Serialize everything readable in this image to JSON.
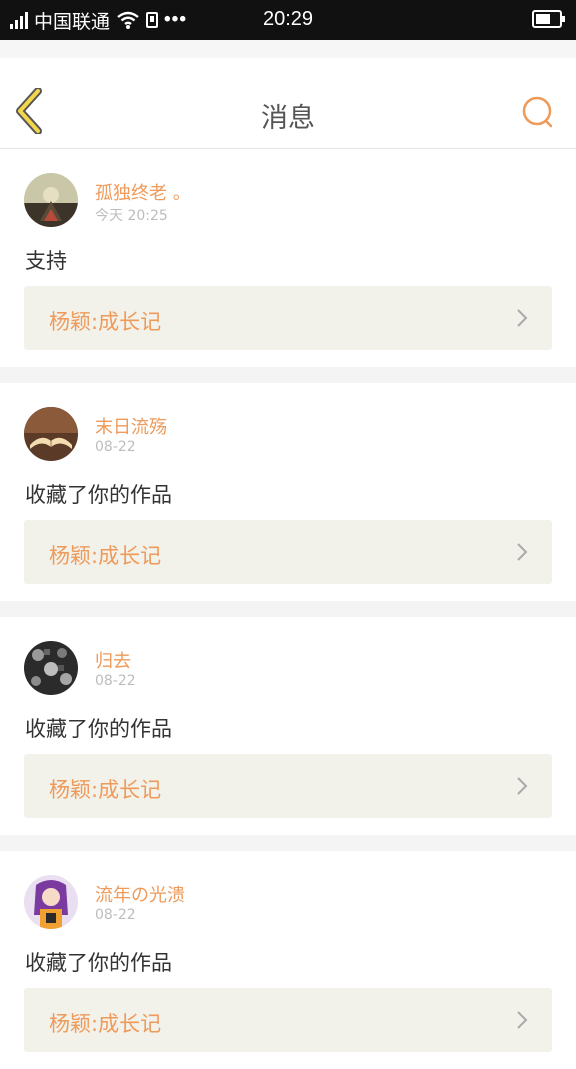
{
  "status_bar": {
    "carrier": "中国联通",
    "time": "20:29",
    "more": "•••"
  },
  "header": {
    "title": "消息",
    "back_icon": "chevron-left-icon",
    "search_icon": "search-icon"
  },
  "colors": {
    "accent": "#ee9a5a",
    "card_bg": "#f2f2ea"
  },
  "messages": [
    {
      "user": "孤独终老 。",
      "time": "今天 20:25",
      "text": "支持",
      "work_title": "杨颖:成长记"
    },
    {
      "user": "末日流殇",
      "time": "08-22",
      "text": "收藏了你的作品",
      "work_title": "杨颖:成长记"
    },
    {
      "user": "归去",
      "time": "08-22",
      "text": "收藏了你的作品",
      "work_title": "杨颖:成长记"
    },
    {
      "user": "流年の光溃",
      "time": "08-22",
      "text": "收藏了你的作品",
      "work_title": "杨颖:成长记"
    }
  ]
}
